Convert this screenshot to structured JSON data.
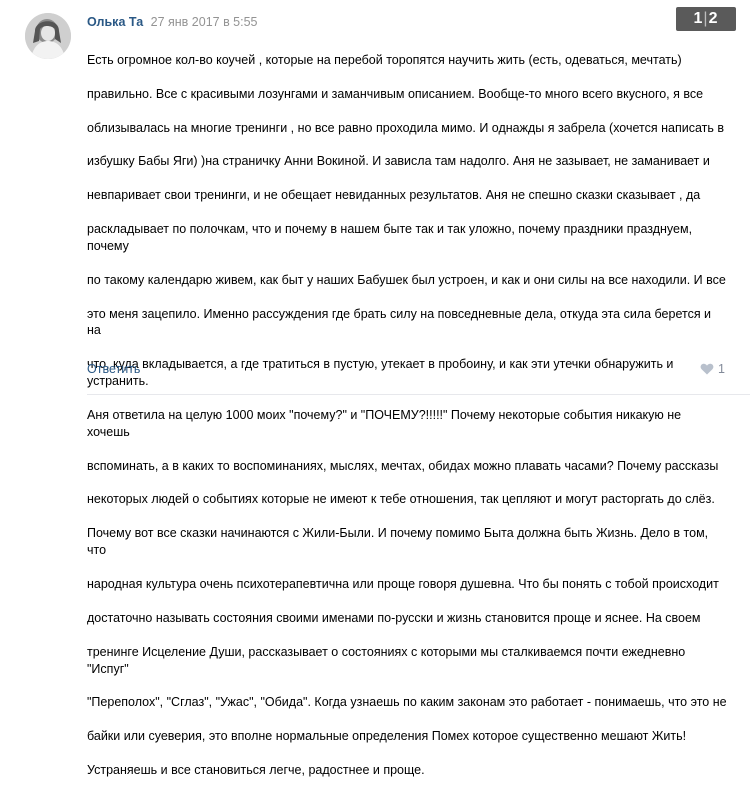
{
  "comment": {
    "author": "Олька Та",
    "date": "27 янв 2017 в 5:55",
    "text_lines": [
      "Есть огромное кол-во коучей , которые на перебой торопятся научить жить (есть, одеваться, мечтать)",
      "правильно. Все с красивыми лозунгами и заманчивым описанием. Вообще-то много всего вкусного, я все",
      "облизывалась на многие тренинги , но все равно проходила мимо. И однажды я забрела (хочется написать в",
      "избушку Бабы Яги) )на страничку Анни Вокиной. И зависла там надолго. Аня не зазывает, не заманивает и",
      "невпаривает свои тренинги, и не обещает невиданных результатов. Аня не спешно сказки сказывает , да",
      "раскладывает по полочкам, что и почему в нашем быте так и так уложно, почему праздники празднуем, почему",
      "по такому календарю живем, как быт у наших Бабушек был устроен, и как и они силы на все находили. И все",
      "это меня зацепило. Именно рассуждения где брать силу на повседневные дела, откуда эта сила берется и на",
      "что, куда вкладывается, а где тратиться в пустую, утекает в пробоину, и как эти утечки обнаружить и устранить.",
      "Аня ответила на целую 1000 моих \"почему?\" и \"ПОЧЕМУ?!!!!!\" Почему некоторые события никакую не хочешь",
      "вспоминать, а в каких то воспоминаниях, мыслях, мечтах, обидах можно плавать часами? Почему рассказы",
      "некоторых людей о событиях которые не имеют к тебе отношения, так цепляют и могут расторгать до слёз.",
      "Почему вот все сказки начинаются с Жили-Были. И почему помимо Быта должна быть Жизнь. Дело в том, что",
      "народная культура очень психотерапевтична или проще говоря душевна. Что бы понять с тобой происходит",
      "достаточно называть состояния своими именами по-русски и жизнь становится проще и яснее. На своем",
      "тренинге Исцеление Души, рассказывает о состояниях с которыми мы сталкиваемся почти ежедневно \"Испуг\"",
      "\"Переполох\", \"Сглаз\", \"Ужас\", \"Обида\". Когда узнаешь по каким законам это работает - понимаешь, что это не",
      "байки или суеверия, это вполне нормальные определения Помех которое существенно мешают Жить!",
      "Устраняешь и все становиться легче, радостнее и проще."
    ],
    "reply_label": "Ответить",
    "likes": "1"
  },
  "pager": {
    "current": "1",
    "total": "2"
  }
}
